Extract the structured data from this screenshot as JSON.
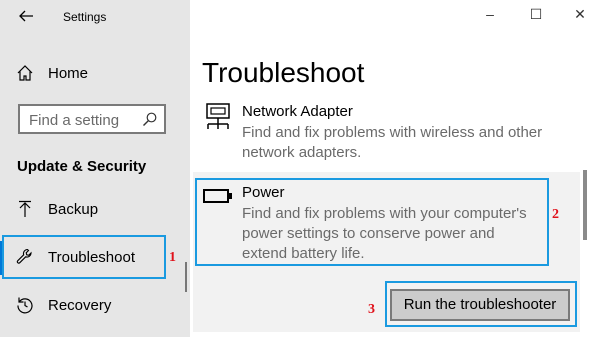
{
  "window": {
    "title": "Settings",
    "controls": [
      "–",
      "☐",
      "✕"
    ]
  },
  "sidebar": {
    "home_label": "Home",
    "search_placeholder": "Find a setting",
    "section_heading": "Update & Security",
    "items": [
      {
        "label": "Backup",
        "icon": "backup-icon"
      },
      {
        "label": "Troubleshoot",
        "icon": "wrench-icon",
        "selected": true
      },
      {
        "label": "Recovery",
        "icon": "recovery-icon"
      }
    ]
  },
  "main": {
    "title": "Troubleshoot",
    "network": {
      "title": "Network Adapter",
      "description": "Find and fix problems with wireless and other network adapters."
    },
    "power": {
      "title": "Power",
      "description": "Find and fix problems with your computer's power settings to conserve power and extend battery life."
    },
    "run_button": "Run the troubleshooter"
  },
  "annotations": {
    "step1": "1",
    "step2": "2",
    "step3": "3"
  },
  "colors": {
    "accent": "#0078d7",
    "highlight_box": "#1a9ae0",
    "step_number": "#e0121b"
  }
}
